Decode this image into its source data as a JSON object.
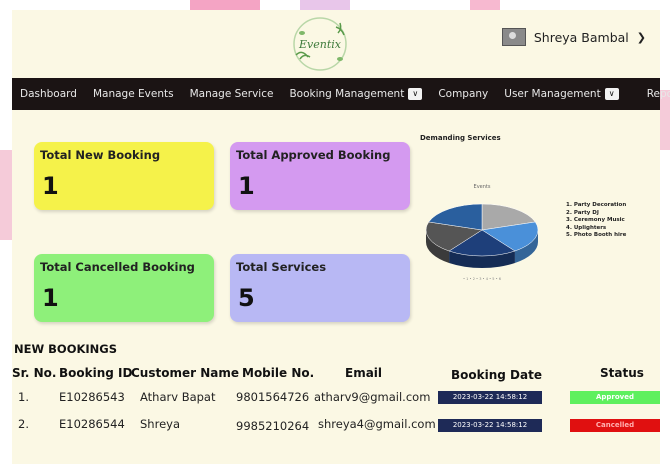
{
  "app": {
    "logo_text": "Eventix"
  },
  "user": {
    "name": "Shreya Bambal"
  },
  "nav": {
    "items": [
      {
        "label": "Dashboard"
      },
      {
        "label": "Manage Events"
      },
      {
        "label": "Manage Service"
      },
      {
        "label": "Booking Management"
      },
      {
        "label": "Company"
      },
      {
        "label": "User Management"
      },
      {
        "label": "Reports"
      }
    ]
  },
  "cards": [
    {
      "title": "Total New Booking",
      "value": "1",
      "color": "#f5f24a"
    },
    {
      "title": "Total Approved Booking",
      "value": "1",
      "color": "#d49af0"
    },
    {
      "title": "Total Cancelled Booking",
      "value": "1",
      "color": "#8ef07a"
    },
    {
      "title": "Total Services",
      "value": "5",
      "color": "#b8b8f4"
    }
  ],
  "chart_data": {
    "type": "pie",
    "title": "Demanding Services",
    "subtitle": "Events",
    "categories": [
      "Party Decoration",
      "Party DJ",
      "Ceremony Music",
      "Uplighters",
      "Photo Booth hire"
    ],
    "values": [
      1,
      1,
      1,
      1,
      1
    ],
    "legend": [
      "1. Party Decoration",
      "2. Party DJ",
      "3. Ceremony Music",
      "4. Uplighters",
      "5. Photo Booth hire"
    ],
    "colors": [
      "#a9a9a9",
      "#4a90d9",
      "#1e3f7a",
      "#555555",
      "#2a5f9e"
    ]
  },
  "bookings": {
    "title": "NEW BOOKINGS",
    "headers": [
      "Sr. No.",
      "Booking ID",
      "Customer Name",
      "Mobile No.",
      "Email",
      "Booking Date",
      "Status"
    ],
    "rows": [
      {
        "sr": "1.",
        "id": "E10286543",
        "name": "Atharv Bapat",
        "mobile": "9801564726",
        "email": "atharv9@gmail.com",
        "date": "2023-03-22 14:58:12",
        "status": "Approved",
        "status_color": "#5ef05e"
      },
      {
        "sr": "2.",
        "id": "E10286544",
        "name": "Shreya",
        "mobile": "9985210264",
        "email": "shreya4@gmail.com",
        "date": "2023-03-22 14:58:12",
        "status": "Cancelled",
        "status_color": "#e01010"
      }
    ]
  }
}
